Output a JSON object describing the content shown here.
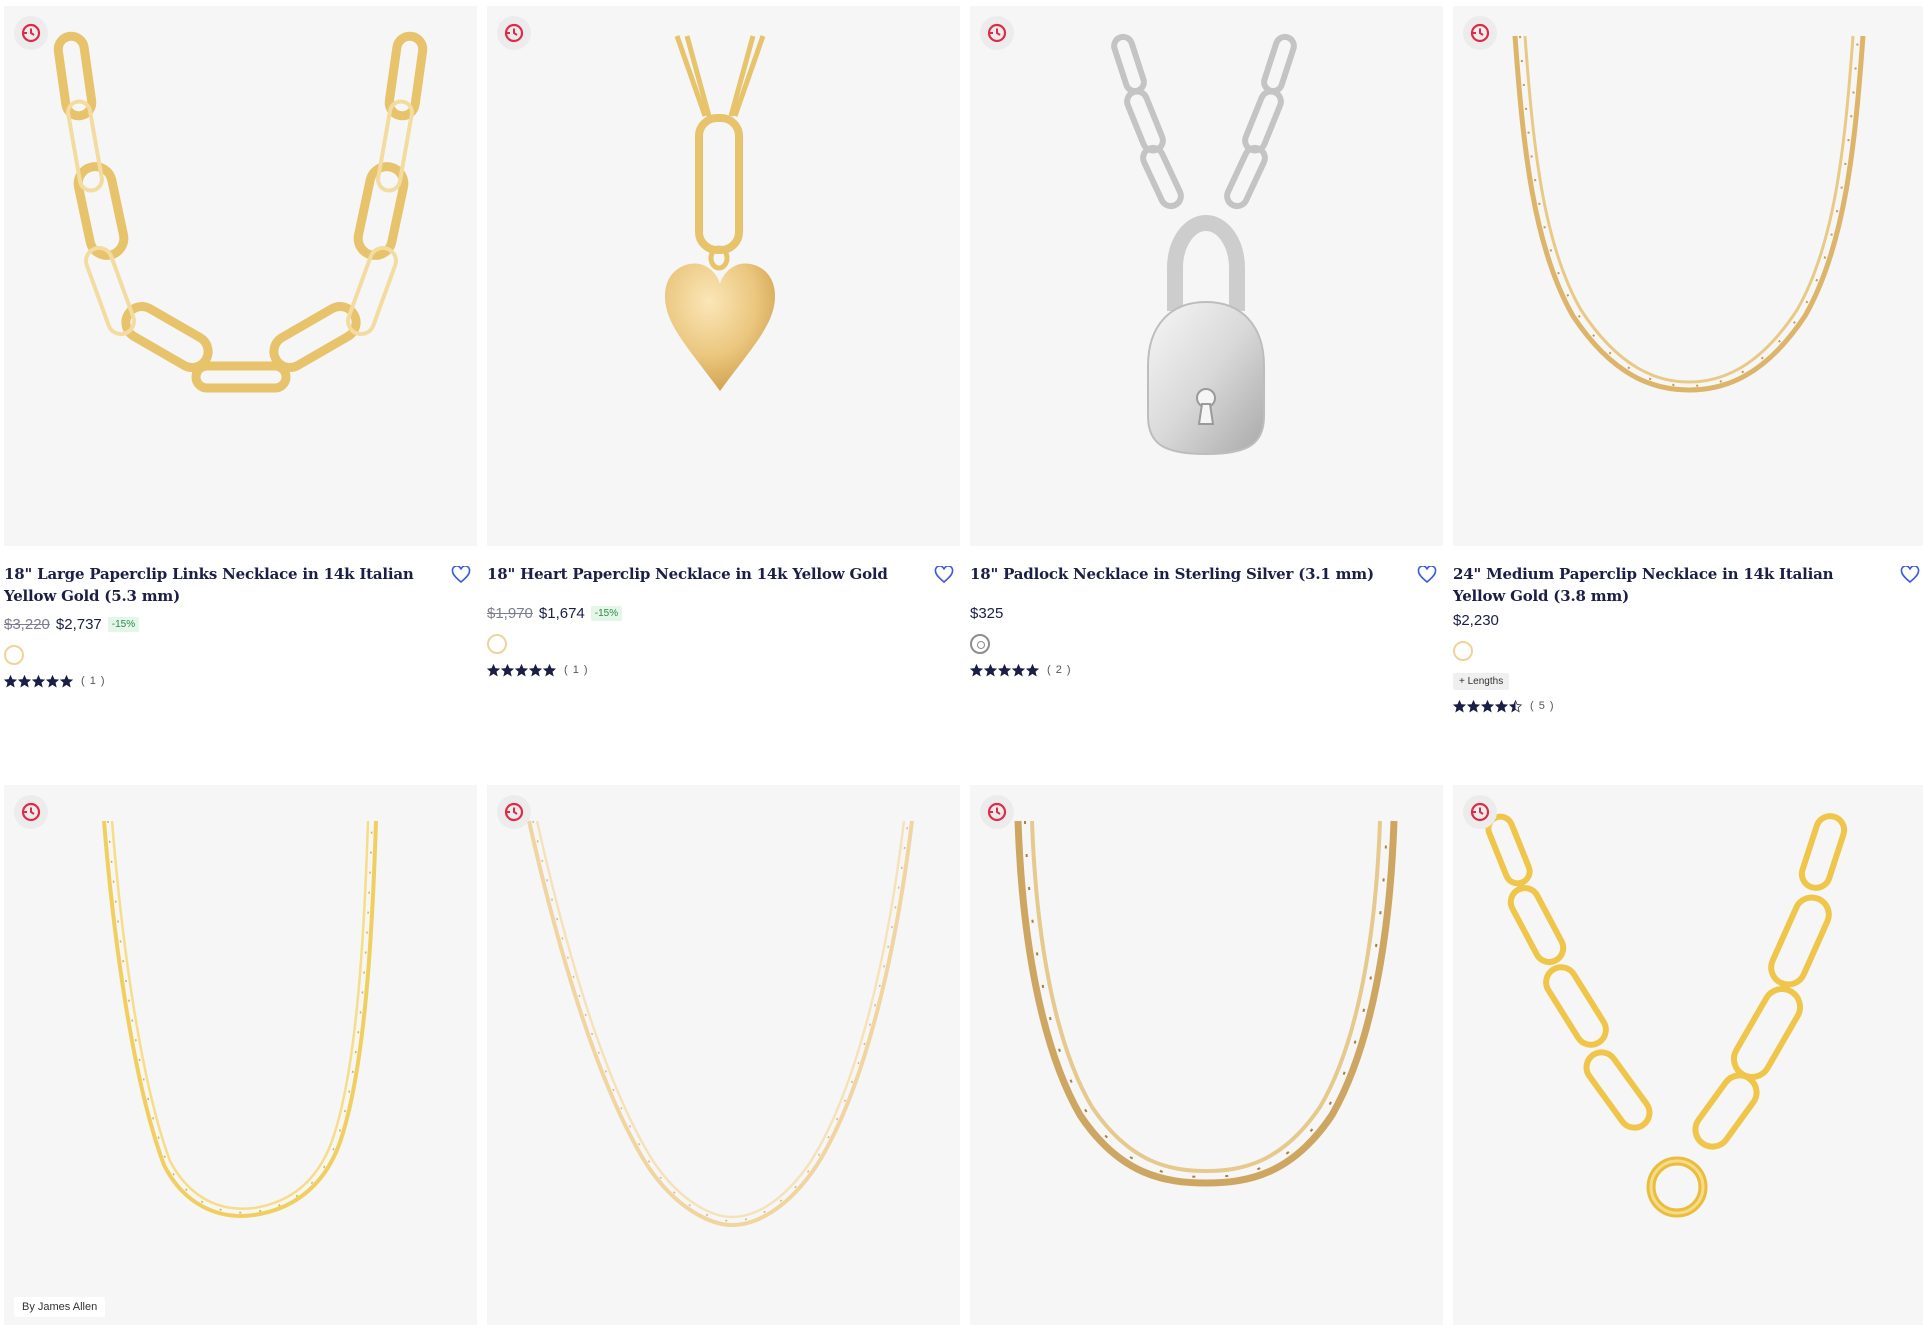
{
  "products": [
    {
      "title": "18\" Large Paperclip Links Necklace in 14k Italian Yellow Gold (5.3 mm)",
      "price_old": "$3,220",
      "price": "$2,737",
      "discount": "-15%",
      "metal": "gold",
      "rating": 5,
      "reviews": "( 1 )",
      "lengths": "",
      "badge": ""
    },
    {
      "title": "18\" Heart Paperclip Necklace in 14k Yellow Gold",
      "price_old": "$1,970",
      "price": "$1,674",
      "discount": "-15%",
      "metal": "gold",
      "rating": 5,
      "reviews": "( 1 )",
      "lengths": "",
      "badge": ""
    },
    {
      "title": "18\" Padlock Necklace in Sterling Silver (3.1 mm)",
      "price_old": "",
      "price": "$325",
      "discount": "",
      "metal": "silver",
      "rating": 5,
      "reviews": "( 2 )",
      "lengths": "",
      "badge": ""
    },
    {
      "title": "24\" Medium Paperclip Necklace in 14k Italian Yellow Gold (3.8 mm)",
      "price_old": "",
      "price": "$2,230",
      "discount": "",
      "metal": "gold",
      "rating": 4.5,
      "reviews": "( 5 )",
      "lengths": "+ Lengths",
      "badge": ""
    },
    {
      "badge": "By James Allen"
    },
    {
      "badge": ""
    },
    {
      "badge": ""
    },
    {
      "badge": ""
    }
  ],
  "colors": {
    "text": "#1b1f45",
    "image_bg": "#f6f6f6",
    "gold": "#e9c46f",
    "silver": "#c9c9c9",
    "heart_outline": "#3b5bdb",
    "badge_red": "#e02b48",
    "discount_green": "#2c8a4a"
  },
  "icons": {
    "quick_ship": "clock-heart-icon",
    "wishlist": "heart-outline-icon",
    "star": "star-icon"
  }
}
